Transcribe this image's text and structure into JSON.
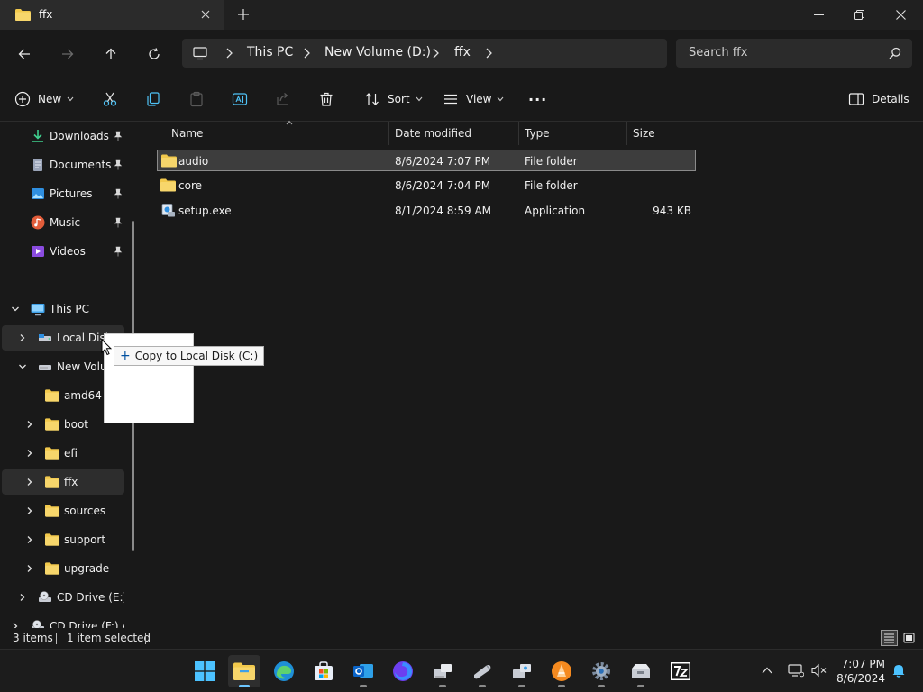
{
  "window": {
    "tab_title": "ffx",
    "new_tab_label": "+",
    "controls": [
      "minimize",
      "restore",
      "close"
    ]
  },
  "address": {
    "crumbs": [
      "This PC",
      "New Volume (D:)",
      "ffx"
    ],
    "search_placeholder": "Search ffx"
  },
  "commands": {
    "new_label": "New",
    "sort_label": "Sort",
    "view_label": "View",
    "more_label": "···",
    "details_label": "Details"
  },
  "nav": {
    "quick_access": [
      {
        "label": "Downloads",
        "icon": "download-icon",
        "pinned": true
      },
      {
        "label": "Documents",
        "icon": "document-icon",
        "pinned": true
      },
      {
        "label": "Pictures",
        "icon": "pictures-icon",
        "pinned": true
      },
      {
        "label": "Music",
        "icon": "music-icon",
        "pinned": true
      },
      {
        "label": "Videos",
        "icon": "videos-icon",
        "pinned": true
      }
    ],
    "this_pc": "This PC",
    "local_disk": "Local Disk",
    "new_volume": "New Volu",
    "folders": [
      "amd64",
      "boot",
      "efi",
      "ffx",
      "sources",
      "support",
      "upgrade"
    ],
    "cd_drive_1": "CD Drive (E:) v",
    "cd_drive_2": "CD Drive (F:) virt"
  },
  "columns": {
    "name": "Name",
    "date": "Date modified",
    "type": "Type",
    "size": "Size"
  },
  "files": [
    {
      "name": "audio",
      "date": "8/6/2024 7:07 PM",
      "type": "File folder",
      "size": "",
      "icon": "folder-icon",
      "selected": true
    },
    {
      "name": "core",
      "date": "8/6/2024 7:04 PM",
      "type": "File folder",
      "size": "",
      "icon": "folder-icon",
      "selected": false
    },
    {
      "name": "setup.exe",
      "date": "8/1/2024 8:59 AM",
      "type": "Application",
      "size": "943 KB",
      "icon": "setup-exe-icon",
      "selected": false
    }
  ],
  "drag": {
    "tooltip": "Copy to Local Disk (C:)",
    "plus": "+"
  },
  "status": {
    "items": "3 items",
    "selected": "1 item selected"
  },
  "taskbar": {
    "apps": [
      "start",
      "file-explorer",
      "edge",
      "store",
      "outlook",
      "firefox",
      "network-tool",
      "usb-tool",
      "setup-tool",
      "vlc",
      "settings",
      "installer",
      "7zip"
    ],
    "time": "7:07 PM",
    "date": "8/6/2024"
  },
  "colors": {
    "folder": "#f2c94c",
    "accent": "#6cc6ff",
    "selection": "#3d3d3d"
  }
}
